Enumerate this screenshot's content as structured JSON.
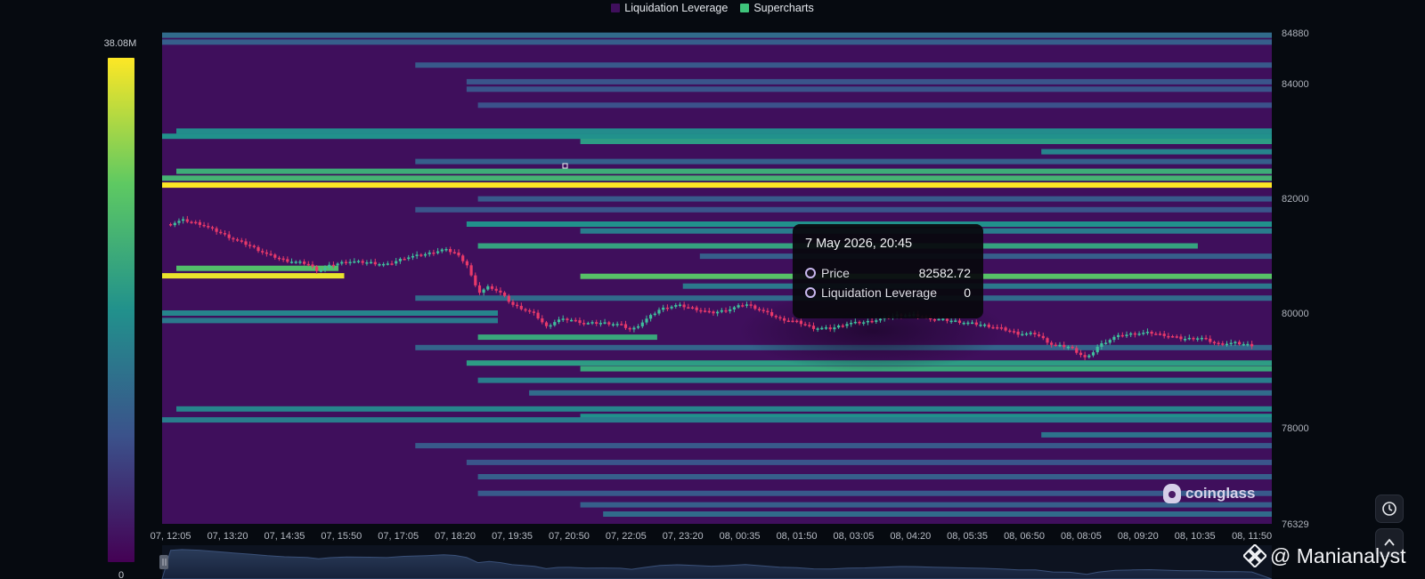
{
  "legend": {
    "items": [
      {
        "label": "Liquidation Leverage",
        "color": "#3f0f5c"
      },
      {
        "label": "Supercharts",
        "color": "#3ec47a"
      }
    ]
  },
  "colorbar": {
    "max_label": "38.08M",
    "min_label": "0",
    "stops": [
      "#440154",
      "#3b528b",
      "#21918c",
      "#5ec962",
      "#fde725"
    ]
  },
  "tooltip": {
    "time": "7 May 2026, 20:45",
    "price_label": "Price",
    "price_value": "82582.72",
    "leverage_label": "Liquidation Leverage",
    "leverage_value": "0"
  },
  "brand": {
    "name": "coinglass"
  },
  "watermark": {
    "text": "@ Manianalyst"
  },
  "icons": {
    "reset": "clock-reset-icon",
    "scroll_top": "chevron-up-icon",
    "drag": "drag-handle-icon"
  },
  "chart_data": {
    "type": "heatmap",
    "title": "",
    "xlabel": "",
    "ylabel": "",
    "background_color": "#3f0f5c",
    "ylim": [
      76329,
      84880
    ],
    "y_ticks": [
      84880,
      84000,
      82000,
      80000,
      78000,
      76329
    ],
    "x_ticks": [
      "07, 12:05",
      "07, 13:20",
      "07, 14:35",
      "07, 15:50",
      "07, 17:05",
      "07, 18:20",
      "07, 19:35",
      "07, 20:50",
      "07, 22:05",
      "07, 23:20",
      "08, 00:35",
      "08, 01:50",
      "08, 03:05",
      "08, 04:20",
      "08, 05:35",
      "08, 06:50",
      "08, 08:05",
      "08, 09:20",
      "08, 10:35",
      "08, 11:50"
    ],
    "bands": [
      {
        "price": 84840,
        "start": 0,
        "end": 19,
        "level": 0.35
      },
      {
        "price": 84720,
        "start": 0,
        "end": 19,
        "level": 0.3
      },
      {
        "price": 84320,
        "start": 4.3,
        "end": 19,
        "level": 0.28
      },
      {
        "price": 84030,
        "start": 5.2,
        "end": 19,
        "level": 0.26
      },
      {
        "price": 83900,
        "start": 5.2,
        "end": 19,
        "level": 0.26
      },
      {
        "price": 83620,
        "start": 5.4,
        "end": 19,
        "level": 0.25
      },
      {
        "price": 83170,
        "start": 0.1,
        "end": 19,
        "level": 0.48
      },
      {
        "price": 83080,
        "start": 0,
        "end": 19,
        "level": 0.5
      },
      {
        "price": 82990,
        "start": 7.2,
        "end": 19,
        "level": 0.55
      },
      {
        "price": 82810,
        "start": 15.3,
        "end": 19,
        "level": 0.45
      },
      {
        "price": 82640,
        "start": 4.3,
        "end": 19,
        "level": 0.3
      },
      {
        "price": 82470,
        "start": 0.1,
        "end": 19,
        "level": 0.62
      },
      {
        "price": 82350,
        "start": 0,
        "end": 19,
        "level": 0.65
      },
      {
        "price": 82230,
        "start": 0,
        "end": 19,
        "level": 1.0
      },
      {
        "price": 81990,
        "start": 5.4,
        "end": 19,
        "level": 0.28
      },
      {
        "price": 81800,
        "start": 4.3,
        "end": 19,
        "level": 0.26
      },
      {
        "price": 81550,
        "start": 5.2,
        "end": 19,
        "level": 0.5
      },
      {
        "price": 81430,
        "start": 7.2,
        "end": 19,
        "level": 0.42
      },
      {
        "price": 81170,
        "start": 5.4,
        "end": 17.7,
        "level": 0.58
      },
      {
        "price": 80990,
        "start": 9.3,
        "end": 19,
        "level": 0.3
      },
      {
        "price": 80780,
        "start": 0.1,
        "end": 2.6,
        "level": 0.7
      },
      {
        "price": 80650,
        "start": 0,
        "end": 2.7,
        "level": 0.97
      },
      {
        "price": 80640,
        "start": 7.2,
        "end": 19,
        "level": 0.72
      },
      {
        "price": 80470,
        "start": 9.0,
        "end": 19,
        "level": 0.4
      },
      {
        "price": 80260,
        "start": 4.3,
        "end": 19,
        "level": 0.35
      },
      {
        "price": 80000,
        "start": 0,
        "end": 5.4,
        "level": 0.45
      },
      {
        "price": 79870,
        "start": 0,
        "end": 5.4,
        "level": 0.4
      },
      {
        "price": 79580,
        "start": 5.4,
        "end": 8.2,
        "level": 0.6
      },
      {
        "price": 79400,
        "start": 4.3,
        "end": 19,
        "level": 0.32
      },
      {
        "price": 79130,
        "start": 5.2,
        "end": 19,
        "level": 0.55
      },
      {
        "price": 79030,
        "start": 7.2,
        "end": 19,
        "level": 0.6
      },
      {
        "price": 78830,
        "start": 5.4,
        "end": 19,
        "level": 0.42
      },
      {
        "price": 78610,
        "start": 6.3,
        "end": 19,
        "level": 0.35
      },
      {
        "price": 78330,
        "start": 0.1,
        "end": 19,
        "level": 0.45
      },
      {
        "price": 78200,
        "start": 7.2,
        "end": 19,
        "level": 0.5
      },
      {
        "price": 78140,
        "start": 0,
        "end": 19,
        "level": 0.42
      },
      {
        "price": 77880,
        "start": 15.3,
        "end": 19,
        "level": 0.38
      },
      {
        "price": 77690,
        "start": 4.3,
        "end": 19,
        "level": 0.28
      },
      {
        "price": 77400,
        "start": 5.2,
        "end": 19,
        "level": 0.26
      },
      {
        "price": 77150,
        "start": 5.4,
        "end": 19,
        "level": 0.3
      },
      {
        "price": 76860,
        "start": 5.4,
        "end": 19,
        "level": 0.28
      },
      {
        "price": 76660,
        "start": 7.2,
        "end": 19,
        "level": 0.3
      },
      {
        "price": 76500,
        "start": 7.6,
        "end": 19,
        "level": 0.35
      }
    ],
    "price_path": [
      [
        0,
        81550
      ],
      [
        0.2,
        81620
      ],
      [
        0.5,
        81560
      ],
      [
        0.8,
        81430
      ],
      [
        1.1,
        81290
      ],
      [
        1.4,
        81170
      ],
      [
        1.7,
        81020
      ],
      [
        2.0,
        80920
      ],
      [
        2.4,
        80860
      ],
      [
        2.6,
        80730
      ],
      [
        2.8,
        80830
      ],
      [
        3.1,
        80900
      ],
      [
        3.5,
        80880
      ],
      [
        3.8,
        80840
      ],
      [
        4.1,
        80960
      ],
      [
        4.5,
        81030
      ],
      [
        4.8,
        81110
      ],
      [
        5.0,
        81050
      ],
      [
        5.2,
        80860
      ],
      [
        5.4,
        80350
      ],
      [
        5.6,
        80470
      ],
      [
        5.8,
        80350
      ],
      [
        6.0,
        80150
      ],
      [
        6.2,
        80070
      ],
      [
        6.4,
        79980
      ],
      [
        6.6,
        79760
      ],
      [
        6.8,
        79880
      ],
      [
        7.0,
        79890
      ],
      [
        7.3,
        79820
      ],
      [
        7.6,
        79830
      ],
      [
        7.9,
        79800
      ],
      [
        8.1,
        79700
      ],
      [
        8.3,
        79850
      ],
      [
        8.6,
        80070
      ],
      [
        8.9,
        80140
      ],
      [
        9.2,
        80080
      ],
      [
        9.5,
        80000
      ],
      [
        9.8,
        80060
      ],
      [
        10.1,
        80160
      ],
      [
        10.4,
        80040
      ],
      [
        10.7,
        79900
      ],
      [
        11.0,
        79850
      ],
      [
        11.3,
        79740
      ],
      [
        11.6,
        79730
      ],
      [
        11.9,
        79820
      ],
      [
        12.2,
        79840
      ],
      [
        12.5,
        79900
      ],
      [
        12.8,
        79970
      ],
      [
        13.1,
        79960
      ],
      [
        13.4,
        79900
      ],
      [
        13.7,
        79870
      ],
      [
        14.0,
        79830
      ],
      [
        14.3,
        79790
      ],
      [
        14.6,
        79730
      ],
      [
        14.9,
        79640
      ],
      [
        15.2,
        79640
      ],
      [
        15.5,
        79440
      ],
      [
        15.8,
        79410
      ],
      [
        16.1,
        79200
      ],
      [
        16.3,
        79430
      ],
      [
        16.6,
        79590
      ],
      [
        16.9,
        79640
      ],
      [
        17.2,
        79660
      ],
      [
        17.5,
        79610
      ],
      [
        17.8,
        79550
      ],
      [
        18.1,
        79570
      ],
      [
        18.4,
        79460
      ],
      [
        18.7,
        79480
      ],
      [
        19.0,
        79440
      ]
    ]
  }
}
